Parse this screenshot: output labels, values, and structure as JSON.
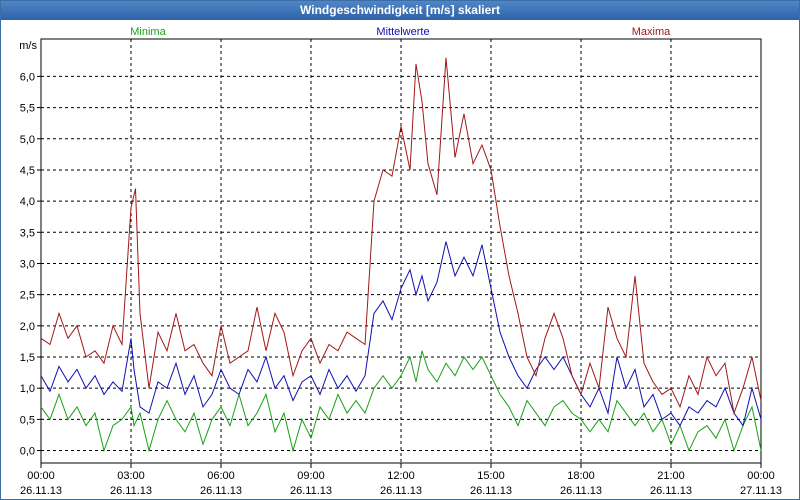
{
  "window": {
    "title": "Windgeschwindigkeit [m/s] skaliert"
  },
  "chart_data": {
    "type": "line",
    "title": "Windgeschwindigkeit [m/s] skaliert",
    "ylabel": "m/s",
    "ylim": [
      -0.2,
      6.6
    ],
    "xlim": [
      0,
      24
    ],
    "yticks": [
      "0,0",
      "0,5",
      "1,0",
      "1,5",
      "2,0",
      "2,5",
      "3,0",
      "3,5",
      "4,0",
      "4,5",
      "5,0",
      "5,5",
      "6,0"
    ],
    "xticks": [
      {
        "time": "00:00",
        "date": "26.11.13"
      },
      {
        "time": "03:00",
        "date": "26.11.13"
      },
      {
        "time": "06:00",
        "date": "26.11.13"
      },
      {
        "time": "09:00",
        "date": "26.11.13"
      },
      {
        "time": "12:00",
        "date": "26.11.13"
      },
      {
        "time": "15:00",
        "date": "26.11.13"
      },
      {
        "time": "18:00",
        "date": "26.11.13"
      },
      {
        "time": "21:00",
        "date": "26.11.13"
      },
      {
        "time": "00:00",
        "date": "27.11.13"
      }
    ],
    "grid": true,
    "series": [
      {
        "name": "Minima",
        "color": "#1aa01a",
        "points": [
          [
            0,
            0.7
          ],
          [
            0.3,
            0.5
          ],
          [
            0.6,
            0.9
          ],
          [
            0.9,
            0.5
          ],
          [
            1.2,
            0.7
          ],
          [
            1.5,
            0.4
          ],
          [
            1.8,
            0.6
          ],
          [
            2.1,
            0.0
          ],
          [
            2.4,
            0.4
          ],
          [
            2.7,
            0.5
          ],
          [
            3.0,
            0.7
          ],
          [
            3.1,
            0.4
          ],
          [
            3.3,
            0.6
          ],
          [
            3.6,
            0.0
          ],
          [
            3.9,
            0.5
          ],
          [
            4.2,
            0.8
          ],
          [
            4.5,
            0.5
          ],
          [
            4.8,
            0.3
          ],
          [
            5.1,
            0.6
          ],
          [
            5.4,
            0.1
          ],
          [
            5.7,
            0.5
          ],
          [
            6.0,
            0.7
          ],
          [
            6.3,
            0.4
          ],
          [
            6.6,
            0.9
          ],
          [
            6.9,
            0.4
          ],
          [
            7.2,
            0.6
          ],
          [
            7.5,
            0.9
          ],
          [
            7.8,
            0.3
          ],
          [
            8.1,
            0.6
          ],
          [
            8.4,
            0.0
          ],
          [
            8.7,
            0.5
          ],
          [
            9.0,
            0.2
          ],
          [
            9.3,
            0.7
          ],
          [
            9.6,
            0.5
          ],
          [
            9.9,
            0.9
          ],
          [
            10.2,
            0.6
          ],
          [
            10.5,
            0.8
          ],
          [
            10.8,
            0.6
          ],
          [
            11.1,
            1.0
          ],
          [
            11.4,
            1.2
          ],
          [
            11.7,
            1.0
          ],
          [
            12.0,
            1.2
          ],
          [
            12.3,
            1.5
          ],
          [
            12.5,
            1.1
          ],
          [
            12.7,
            1.6
          ],
          [
            12.9,
            1.3
          ],
          [
            13.2,
            1.1
          ],
          [
            13.5,
            1.4
          ],
          [
            13.8,
            1.2
          ],
          [
            14.1,
            1.5
          ],
          [
            14.4,
            1.3
          ],
          [
            14.7,
            1.5
          ],
          [
            15.0,
            1.2
          ],
          [
            15.3,
            0.9
          ],
          [
            15.6,
            0.7
          ],
          [
            15.9,
            0.4
          ],
          [
            16.2,
            0.8
          ],
          [
            16.5,
            0.6
          ],
          [
            16.8,
            0.4
          ],
          [
            17.1,
            0.7
          ],
          [
            17.4,
            0.8
          ],
          [
            17.7,
            0.6
          ],
          [
            18.0,
            0.5
          ],
          [
            18.3,
            0.3
          ],
          [
            18.6,
            0.5
          ],
          [
            18.9,
            0.3
          ],
          [
            19.2,
            0.8
          ],
          [
            19.5,
            0.6
          ],
          [
            19.8,
            0.4
          ],
          [
            20.1,
            0.6
          ],
          [
            20.4,
            0.3
          ],
          [
            20.7,
            0.5
          ],
          [
            21.0,
            0.1
          ],
          [
            21.3,
            0.4
          ],
          [
            21.6,
            0.0
          ],
          [
            21.9,
            0.3
          ],
          [
            22.2,
            0.4
          ],
          [
            22.5,
            0.2
          ],
          [
            22.8,
            0.5
          ],
          [
            23.1,
            0.0
          ],
          [
            23.4,
            0.4
          ],
          [
            23.7,
            0.7
          ],
          [
            24.0,
            0.0
          ]
        ]
      },
      {
        "name": "Mittelwerte",
        "color": "#1010b0",
        "points": [
          [
            0,
            1.2
          ],
          [
            0.3,
            0.95
          ],
          [
            0.6,
            1.35
          ],
          [
            0.9,
            1.1
          ],
          [
            1.2,
            1.3
          ],
          [
            1.5,
            1.0
          ],
          [
            1.8,
            1.2
          ],
          [
            2.1,
            0.9
          ],
          [
            2.4,
            1.1
          ],
          [
            2.7,
            0.95
          ],
          [
            3.0,
            1.8
          ],
          [
            3.1,
            1.3
          ],
          [
            3.3,
            0.7
          ],
          [
            3.6,
            0.6
          ],
          [
            3.9,
            1.1
          ],
          [
            4.2,
            1.0
          ],
          [
            4.5,
            1.4
          ],
          [
            4.8,
            0.9
          ],
          [
            5.1,
            1.2
          ],
          [
            5.4,
            0.7
          ],
          [
            5.7,
            0.9
          ],
          [
            6.0,
            1.3
          ],
          [
            6.3,
            1.0
          ],
          [
            6.6,
            0.9
          ],
          [
            6.9,
            1.3
          ],
          [
            7.2,
            1.1
          ],
          [
            7.5,
            1.5
          ],
          [
            7.8,
            1.0
          ],
          [
            8.1,
            1.2
          ],
          [
            8.4,
            0.8
          ],
          [
            8.7,
            1.1
          ],
          [
            9.0,
            1.2
          ],
          [
            9.3,
            0.9
          ],
          [
            9.6,
            1.3
          ],
          [
            9.9,
            1.0
          ],
          [
            10.2,
            1.2
          ],
          [
            10.5,
            0.95
          ],
          [
            10.8,
            1.2
          ],
          [
            11.1,
            2.2
          ],
          [
            11.4,
            2.4
          ],
          [
            11.7,
            2.1
          ],
          [
            12.0,
            2.6
          ],
          [
            12.3,
            2.9
          ],
          [
            12.5,
            2.5
          ],
          [
            12.7,
            2.8
          ],
          [
            12.9,
            2.4
          ],
          [
            13.2,
            2.7
          ],
          [
            13.5,
            3.35
          ],
          [
            13.8,
            2.8
          ],
          [
            14.1,
            3.1
          ],
          [
            14.4,
            2.8
          ],
          [
            14.7,
            3.3
          ],
          [
            15.0,
            2.6
          ],
          [
            15.3,
            1.9
          ],
          [
            15.6,
            1.5
          ],
          [
            15.9,
            1.2
          ],
          [
            16.2,
            1.0
          ],
          [
            16.5,
            1.3
          ],
          [
            16.8,
            1.5
          ],
          [
            17.1,
            1.3
          ],
          [
            17.4,
            1.5
          ],
          [
            17.7,
            1.2
          ],
          [
            18.0,
            0.9
          ],
          [
            18.3,
            0.7
          ],
          [
            18.6,
            1.0
          ],
          [
            18.9,
            0.6
          ],
          [
            19.2,
            1.5
          ],
          [
            19.5,
            1.0
          ],
          [
            19.8,
            1.3
          ],
          [
            20.1,
            0.7
          ],
          [
            20.4,
            0.9
          ],
          [
            20.7,
            0.5
          ],
          [
            21.0,
            0.6
          ],
          [
            21.3,
            0.4
          ],
          [
            21.6,
            0.7
          ],
          [
            21.9,
            0.6
          ],
          [
            22.2,
            0.8
          ],
          [
            22.5,
            0.7
          ],
          [
            22.8,
            1.0
          ],
          [
            23.1,
            0.6
          ],
          [
            23.4,
            0.4
          ],
          [
            23.7,
            1.0
          ],
          [
            24.0,
            0.5
          ]
        ]
      },
      {
        "name": "Maxima",
        "color": "#a01818",
        "points": [
          [
            0,
            1.8
          ],
          [
            0.3,
            1.7
          ],
          [
            0.6,
            2.2
          ],
          [
            0.9,
            1.8
          ],
          [
            1.2,
            2.0
          ],
          [
            1.5,
            1.5
          ],
          [
            1.8,
            1.6
          ],
          [
            2.1,
            1.4
          ],
          [
            2.4,
            2.0
          ],
          [
            2.7,
            1.7
          ],
          [
            3.0,
            3.9
          ],
          [
            3.15,
            4.2
          ],
          [
            3.3,
            2.2
          ],
          [
            3.6,
            1.0
          ],
          [
            3.9,
            1.9
          ],
          [
            4.2,
            1.6
          ],
          [
            4.5,
            2.2
          ],
          [
            4.8,
            1.6
          ],
          [
            5.1,
            1.7
          ],
          [
            5.4,
            1.4
          ],
          [
            5.7,
            1.2
          ],
          [
            6.0,
            2.0
          ],
          [
            6.3,
            1.4
          ],
          [
            6.6,
            1.5
          ],
          [
            6.9,
            1.6
          ],
          [
            7.2,
            2.3
          ],
          [
            7.5,
            1.6
          ],
          [
            7.8,
            2.2
          ],
          [
            8.1,
            1.9
          ],
          [
            8.4,
            1.2
          ],
          [
            8.7,
            1.6
          ],
          [
            9.0,
            1.8
          ],
          [
            9.3,
            1.4
          ],
          [
            9.6,
            1.7
          ],
          [
            9.9,
            1.6
          ],
          [
            10.2,
            1.9
          ],
          [
            10.5,
            1.8
          ],
          [
            10.8,
            1.7
          ],
          [
            11.1,
            4.0
          ],
          [
            11.4,
            4.5
          ],
          [
            11.7,
            4.4
          ],
          [
            12.0,
            5.2
          ],
          [
            12.3,
            4.5
          ],
          [
            12.5,
            6.2
          ],
          [
            12.7,
            5.6
          ],
          [
            12.9,
            4.6
          ],
          [
            13.2,
            4.1
          ],
          [
            13.5,
            6.3
          ],
          [
            13.8,
            4.7
          ],
          [
            14.1,
            5.4
          ],
          [
            14.4,
            4.6
          ],
          [
            14.7,
            4.9
          ],
          [
            15.0,
            4.5
          ],
          [
            15.3,
            3.6
          ],
          [
            15.6,
            2.8
          ],
          [
            15.9,
            2.2
          ],
          [
            16.2,
            1.5
          ],
          [
            16.5,
            1.2
          ],
          [
            16.8,
            1.8
          ],
          [
            17.1,
            2.2
          ],
          [
            17.4,
            1.8
          ],
          [
            17.7,
            1.2
          ],
          [
            18.0,
            0.9
          ],
          [
            18.3,
            1.4
          ],
          [
            18.6,
            1.0
          ],
          [
            18.9,
            2.3
          ],
          [
            19.2,
            1.8
          ],
          [
            19.5,
            1.5
          ],
          [
            19.8,
            2.8
          ],
          [
            20.1,
            1.4
          ],
          [
            20.4,
            1.1
          ],
          [
            20.7,
            0.9
          ],
          [
            21.0,
            1.0
          ],
          [
            21.3,
            0.7
          ],
          [
            21.6,
            1.2
          ],
          [
            21.9,
            0.9
          ],
          [
            22.2,
            1.5
          ],
          [
            22.5,
            1.2
          ],
          [
            22.8,
            1.4
          ],
          [
            23.1,
            0.6
          ],
          [
            23.4,
            1.0
          ],
          [
            23.7,
            1.5
          ],
          [
            24.0,
            0.8
          ]
        ]
      }
    ]
  }
}
